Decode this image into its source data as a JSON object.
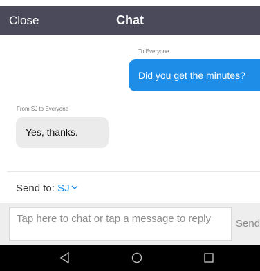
{
  "header": {
    "close_label": "Close",
    "title": "Chat"
  },
  "messages": [
    {
      "direction": "outgoing",
      "meta": "To Everyone",
      "text": "Did you get the minutes?"
    },
    {
      "direction": "incoming",
      "meta": "From SJ to Everyone",
      "text": "Yes, thanks."
    }
  ],
  "composer": {
    "send_to_label": "Send to:",
    "send_to_target": "SJ",
    "placeholder": "Tap here to chat or tap a message to reply",
    "send_label": "Send"
  },
  "navbar": {
    "icons": [
      "back-icon",
      "home-icon",
      "recents-icon"
    ]
  },
  "colors": {
    "header_bg": "#4a4a5a",
    "accent": "#1e8de8",
    "incoming_bubble": "#ebebeb"
  }
}
